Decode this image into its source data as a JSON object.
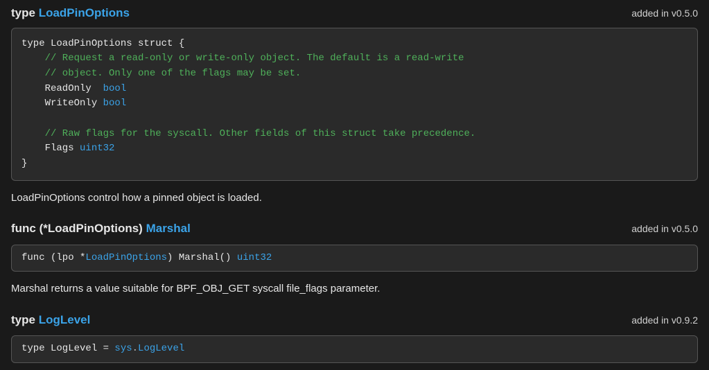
{
  "sections": [
    {
      "kind": "type",
      "name": "LoadPinOptions",
      "version": "added in v0.5.0",
      "description": "LoadPinOptions control how a pinned object is loaded."
    },
    {
      "kind": "func",
      "receiver": "(*LoadPinOptions)",
      "name": "Marshal",
      "version": "added in v0.5.0",
      "description": "Marshal returns a value suitable for BPF_OBJ_GET syscall file_flags parameter."
    },
    {
      "kind": "type",
      "name": "LogLevel",
      "version": "added in v0.9.2"
    }
  ],
  "code": {
    "loadpin": {
      "l1": "type LoadPinOptions struct {",
      "c1": "    // Request a read-only or write-only object. The default is a read-write",
      "c2": "    // object. Only one of the flags may be set.",
      "f1a": "    ReadOnly  ",
      "f1b": "bool",
      "f2a": "    WriteOnly ",
      "f2b": "bool",
      "c3": "    // Raw flags for the syscall. Other fields of this struct take precedence.",
      "f3a": "    Flags ",
      "f3b": "uint32",
      "l9": "}"
    },
    "marshal": {
      "p1": "func (lpo *",
      "p2": "LoadPinOptions",
      "p3": ") Marshal() ",
      "p4": "uint32"
    },
    "loglevel": {
      "p1": "type LogLevel = ",
      "p2": "sys",
      "p3": ".",
      "p4": "LogLevel"
    }
  }
}
